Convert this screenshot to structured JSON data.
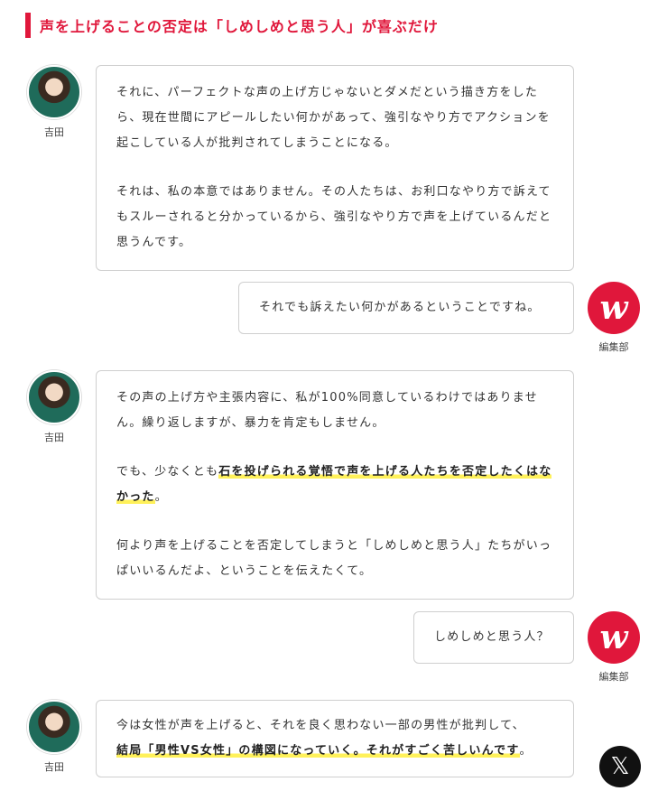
{
  "heading": "声を上げることの否定は「しめしめと思う人」が喜ぶだけ",
  "speakers": {
    "guest": "吉田",
    "editor": "編集部"
  },
  "logo_glyph": "w",
  "messages": [
    {
      "p1": "それに、パーフェクトな声の上げ方じゃないとダメだという描き方をしたら、現在世間にアピールしたい何かがあって、強引なやり方でアクションを起こしている人が批判されてしまうことになる。",
      "p2": "それは、私の本意ではありません。その人たちは、お利口なやり方で訴えてもスルーされると分かっているから、強引なやり方で声を上げているんだと思うんです。"
    },
    {
      "p1": "それでも訴えたい何かがあるということですね。"
    },
    {
      "p1": "その声の上げ方や主張内容に、私が100%同意しているわけではありません。繰り返しますが、暴力を肯定もしません。",
      "p2_pre": "でも、少なくとも",
      "p2_hl": "石を投げられる覚悟で声を上げる人たちを否定したくはなかった",
      "p2_post": "。",
      "p3": "何より声を上げることを否定してしまうと「しめしめと思う人」たちがいっぱいいるんだよ、ということを伝えたくて。"
    },
    {
      "p1": "しめしめと思う人？"
    },
    {
      "p1": "今は女性が声を上げると、それを良く思わない一部の男性が批判して、",
      "p2_hl": "結局「男性VS女性」の構図になっていく。それがすごく苦しいんです",
      "p2_post": "。"
    }
  ],
  "share": {
    "x_icon": "𝕏"
  }
}
